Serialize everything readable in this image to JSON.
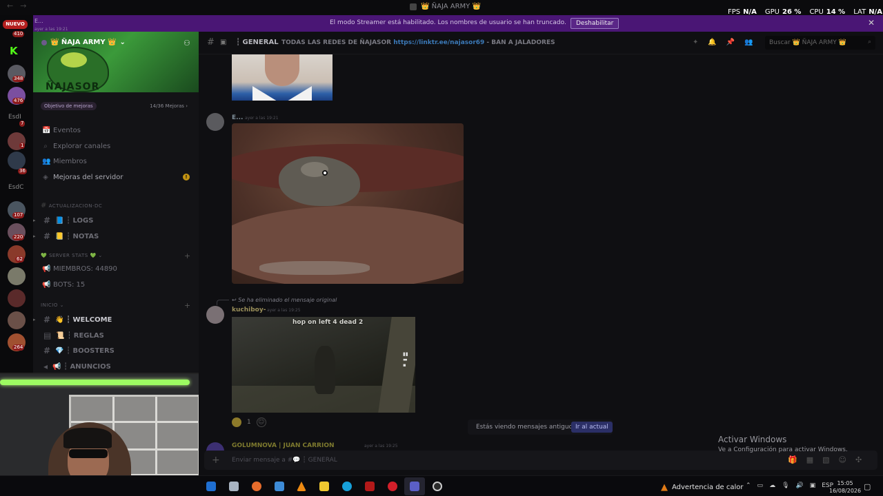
{
  "window": {
    "title": "👑 ÑAJA ARMY 👑",
    "nav_back": "←",
    "nav_fwd": "→"
  },
  "stats": {
    "fps_label": "FPS",
    "fps_value": "N/A",
    "gpu_label": "GPU",
    "gpu_value": "26 %",
    "cpu_label": "CPU",
    "cpu_value": "14 %",
    "lat_label": "LAT",
    "lat_value": "N/A"
  },
  "banner": {
    "message": "El modo Streamer está habilitado. Los nombres de usuario se han truncado.",
    "button": "Deshabilitar",
    "close": "✕",
    "left_text": "E...",
    "left_sub": "ayer a las 19:21"
  },
  "rail": {
    "nuevo": "NUEVO",
    "k_app": "K",
    "badges": [
      "410",
      "348",
      "476",
      "7",
      "1",
      "36",
      "107",
      "220",
      "62",
      "264"
    ],
    "label_esd1": "EsdI",
    "label_esd2": "EsdC"
  },
  "server": {
    "name": "👑 ÑAJA ARMY 👑",
    "banner_logo": "ÑAJASOR",
    "boost_label": "Objetivo de mejoras",
    "boost_count": "14/36 Mejoras",
    "boost_arrow": "›"
  },
  "sidebar": {
    "items": [
      {
        "icon": "📅",
        "label": "Eventos"
      },
      {
        "icon": "⌕",
        "label": "Explorar canales"
      },
      {
        "icon": "👥",
        "label": "Miembros"
      },
      {
        "icon": "◈",
        "label": "Mejoras del servidor"
      }
    ],
    "warn_badge": "!",
    "categories": {
      "actualizacion": "ACTUALIZACION-DC",
      "server_stats": "💚 SERVER STATS 💚",
      "inicio": "INICIO"
    },
    "channels_upd": [
      {
        "label": "📘 ┆ LOGS"
      },
      {
        "label": "📒 ┆ NOTAS"
      }
    ],
    "stats_channels": [
      {
        "icon": "📢",
        "label": "MIEMBROS: 44890"
      },
      {
        "icon": "📢",
        "label": "BOTS: 15"
      }
    ],
    "channels_inicio": [
      {
        "label": "👋 ┆ WELCOME"
      },
      {
        "label": "📜 ┆ REGLAS"
      },
      {
        "label": "💎 ┆ BOOSTERS"
      },
      {
        "label": "📢 ┆ ANUNCIOS"
      }
    ],
    "plus": "+"
  },
  "chat": {
    "channel_name": "GENERAL",
    "topic_text": "TODAS LAS REDES DE ÑAJASOR ",
    "topic_link": "https://linktr.ee/najasor69",
    "topic_tail": " - BAN A JALADORES",
    "search_placeholder": "Buscar 👑 ÑAJA ARMY 👑",
    "messages": [
      {
        "author": "E...",
        "time": "ayer a las 19:21"
      },
      {
        "author": "kuchiboy-",
        "time": "ayer a las 19:25"
      },
      {
        "author": "GOLUMNOVA | JUAN CARRION",
        "time": "ayer a las 19:25"
      }
    ],
    "deleted_reply": "Se ha eliminado el mensaje original",
    "game_caption": "hop on left 4 dead 2",
    "reaction_count": "1",
    "old_messages": "Estás viendo mensajes antiguos",
    "jump_button": "Ir al actual",
    "composer_placeholder": "Enviar mensaje a #💬 ┆ GENERAL"
  },
  "watermark": {
    "line1": "Activar Windows",
    "line2": "Ve a Configuración para activar Windows."
  },
  "taskbar": {
    "heat_warning": "Advertencia de calor",
    "lang": "ESP",
    "time": "15:05",
    "date": "16/08/2026"
  }
}
